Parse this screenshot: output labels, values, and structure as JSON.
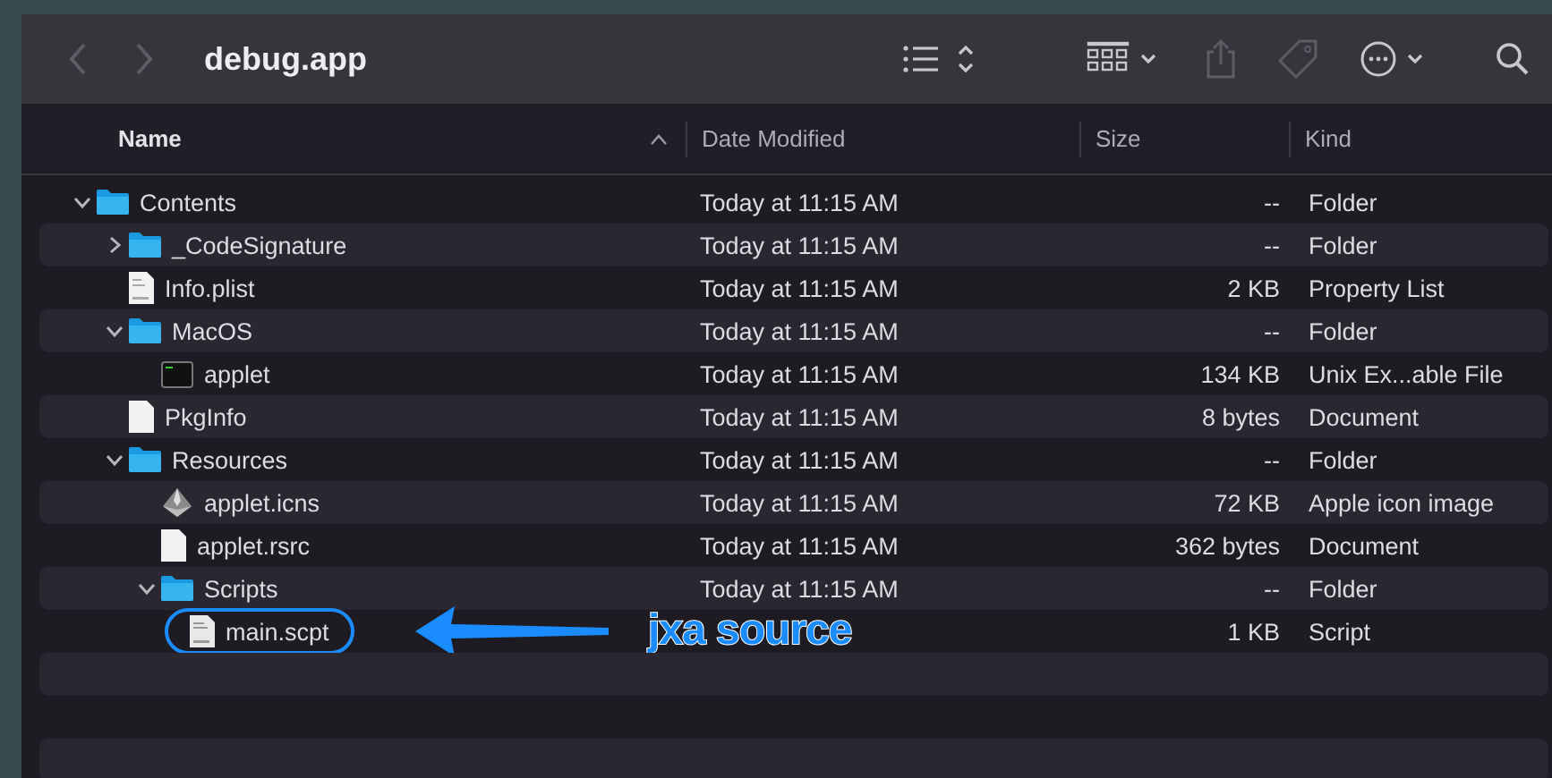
{
  "window": {
    "title": "debug.app"
  },
  "columns": [
    {
      "label": "Name",
      "sorted": true
    },
    {
      "label": "Date Modified",
      "sorted": false
    },
    {
      "label": "Size",
      "sorted": false
    },
    {
      "label": "Kind",
      "sorted": false
    }
  ],
  "files": [
    {
      "name": "Contents",
      "kind": "folder",
      "expanded": true,
      "date": "Today at 11:15 AM",
      "size": "--",
      "file_kind": "Folder",
      "children": [
        {
          "name": "_CodeSignature",
          "kind": "folder",
          "expanded": false,
          "date": "Today at 11:15 AM",
          "size": "--",
          "file_kind": "Folder"
        },
        {
          "name": "Info.plist",
          "kind": "plist",
          "date": "Today at 11:15 AM",
          "size": "2 KB",
          "file_kind": "Property List"
        },
        {
          "name": "MacOS",
          "kind": "folder",
          "expanded": true,
          "date": "Today at 11:15 AM",
          "size": "--",
          "file_kind": "Folder",
          "children": [
            {
              "name": "applet",
              "kind": "terminal",
              "date": "Today at 11:15 AM",
              "size": "134 KB",
              "file_kind": "Unix Ex...able File"
            }
          ]
        },
        {
          "name": "PkgInfo",
          "kind": "document",
          "date": "Today at 11:15 AM",
          "size": "8 bytes",
          "file_kind": "Document"
        },
        {
          "name": "Resources",
          "kind": "folder",
          "expanded": true,
          "date": "Today at 11:15 AM",
          "size": "--",
          "file_kind": "Folder",
          "children": [
            {
              "name": "applet.icns",
              "kind": "icns",
              "date": "Today at 11:15 AM",
              "size": "72 KB",
              "file_kind": "Apple icon image"
            },
            {
              "name": "applet.rsrc",
              "kind": "document",
              "date": "Today at 11:15 AM",
              "size": "362 bytes",
              "file_kind": "Document"
            },
            {
              "name": "Scripts",
              "kind": "folder",
              "expanded": true,
              "date": "Today at 11:15 AM",
              "size": "--",
              "file_kind": "Folder",
              "children": [
                {
                  "name": "main.scpt",
                  "kind": "script",
                  "circled": true,
                  "size": "1 KB",
                  "file_kind": "Script"
                }
              ]
            }
          ]
        }
      ]
    }
  ],
  "annotation": {
    "label": "jxa source"
  }
}
